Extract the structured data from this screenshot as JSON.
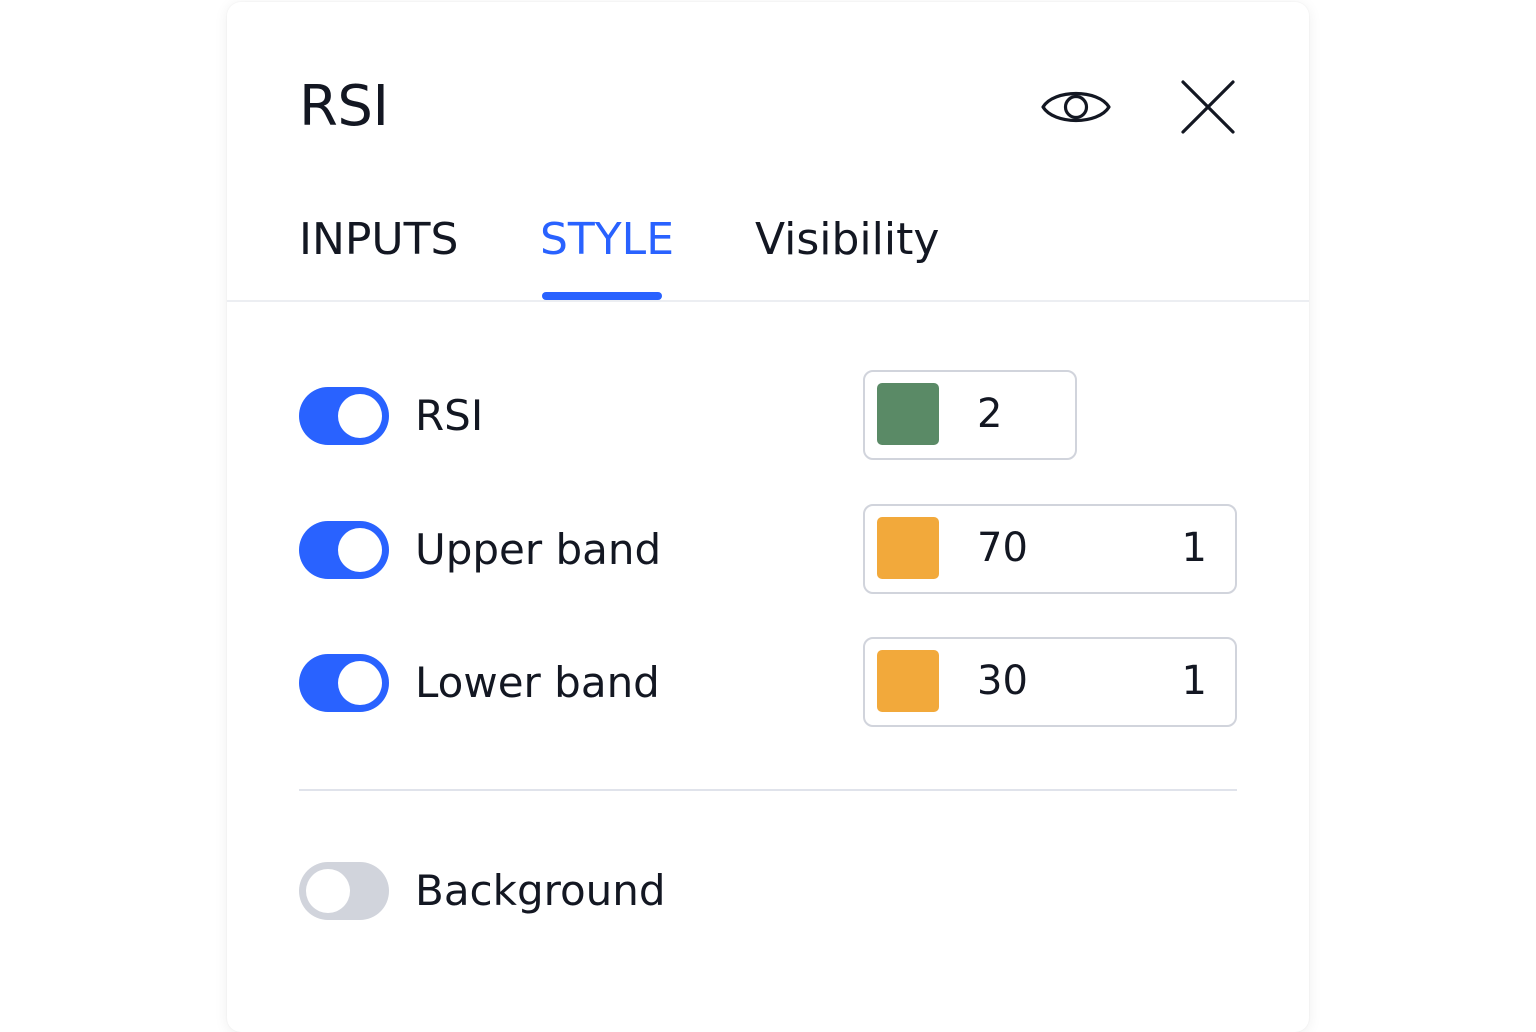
{
  "dialog": {
    "title": "RSI",
    "header_icons": [
      "eye-icon",
      "close-icon"
    ]
  },
  "tabs": [
    {
      "label": "INPUTS",
      "active": false
    },
    {
      "label": "STYLE",
      "active": true
    },
    {
      "label": "Visibility",
      "active": false
    }
  ],
  "style_rows": [
    {
      "label": "RSI",
      "enabled": true,
      "color": "#5a8a66",
      "value": "2",
      "width": ""
    },
    {
      "label": "Upper band",
      "enabled": true,
      "color": "#f2a93b",
      "value": "70",
      "width": "1"
    },
    {
      "label": "Lower band",
      "enabled": true,
      "color": "#f2a93b",
      "value": "30",
      "width": "1"
    }
  ],
  "background_row": {
    "label": "Background",
    "enabled": false
  },
  "colors": {
    "accent": "#2962ff",
    "toggle_off": "#d1d4dc",
    "text": "#131722"
  }
}
